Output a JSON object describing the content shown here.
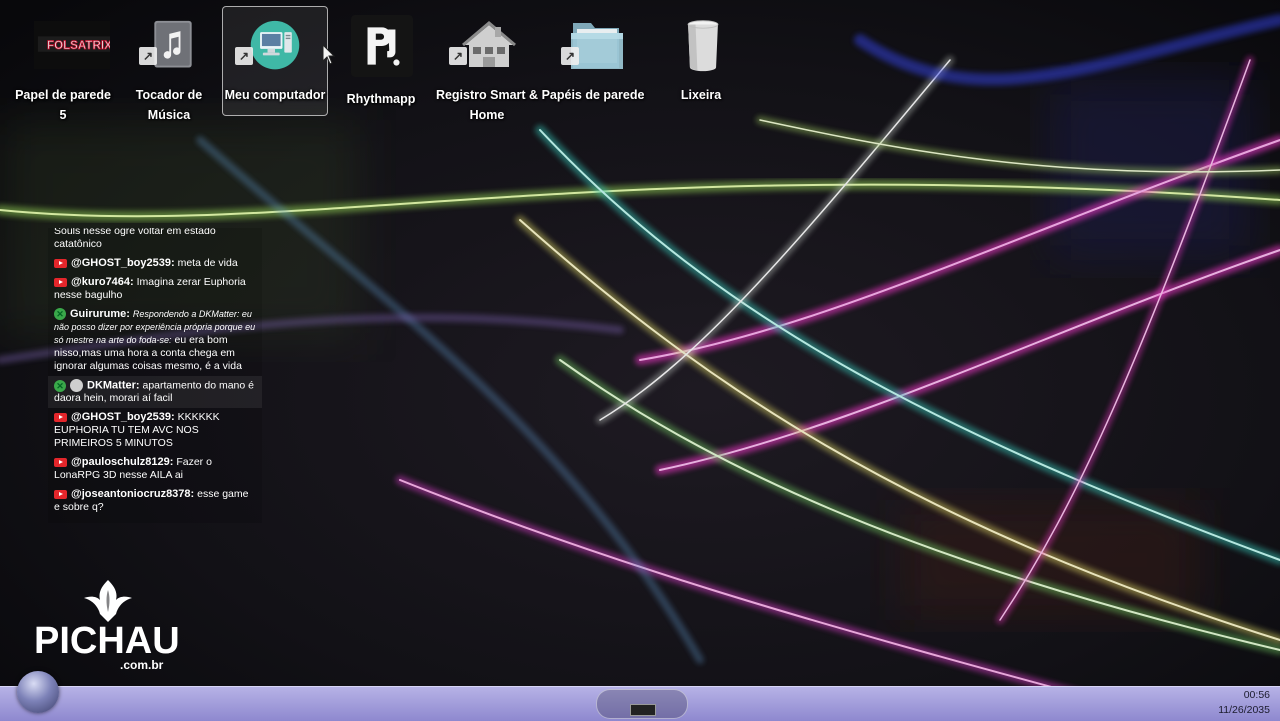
{
  "desktop": {
    "icons": [
      {
        "label": "Papel de parede 5",
        "icon": "folsatrix-wallpaper-image-icon",
        "logo_text": "FOLSATRIX",
        "shortcut": false,
        "selected": false
      },
      {
        "label": "Tocador de Música",
        "icon": "music-player-icon",
        "shortcut": true,
        "selected": false
      },
      {
        "label": "Meu computador",
        "icon": "computer-icon",
        "shortcut": true,
        "selected": true
      },
      {
        "label": "Rhythmapp",
        "icon": "rhythmapp-logo-icon",
        "logo_text": "R",
        "shortcut": false,
        "selected": false
      },
      {
        "label": "Registro Smart & Home",
        "icon": "house-icon",
        "shortcut": true,
        "selected": false
      },
      {
        "label": "Papéis de parede",
        "icon": "folder-icon",
        "shortcut": true,
        "selected": false
      },
      {
        "label": "Lixeira",
        "icon": "trash-bin-icon",
        "shortcut": false,
        "selected": false
      }
    ]
  },
  "chat": {
    "messages": [
      {
        "platform": "youtube",
        "author": "",
        "text": "Souls nesse ogre voltar em estado catatônico",
        "partial": true
      },
      {
        "platform": "youtube",
        "author": "@GHOST_boy2539:",
        "text": "meta de vida"
      },
      {
        "platform": "youtube",
        "author": "@kuro7464:",
        "text": "Imagina zerar Euphoria nesse bagulho"
      },
      {
        "platform": "xbox",
        "author": "Guirurume:",
        "reply": "Respondendo a DKMatter: eu não posso dizer por experiência própria porque eu só mestre na arte do foda-se:",
        "text": "eu era bom nisso,mas uma hora a conta chega em ignorar algumas coisas mesmo, é a vida"
      },
      {
        "platform": "xbox",
        "author": "DKMatter:",
        "text": "apartamento do mano é daora hein, morari aí facil",
        "highlight": true
      },
      {
        "platform": "youtube",
        "author": "@GHOST_boy2539:",
        "text": "KKKKKK EUPHORIA TU TEM AVC NOS PRIMEIROS 5 MINUTOS"
      },
      {
        "platform": "youtube",
        "author": "@pauloschulz8129:",
        "text": "Fazer o LonaRPG 3D nesse AILA ai"
      },
      {
        "platform": "youtube",
        "author": "@joseantoniocruz8378:",
        "text": "esse game e sobre q?"
      }
    ]
  },
  "watermark": {
    "brand": "PICHAU",
    "domain": ".com.br"
  },
  "taskbar": {
    "time": "00:56",
    "date": "11/26/2035"
  }
}
